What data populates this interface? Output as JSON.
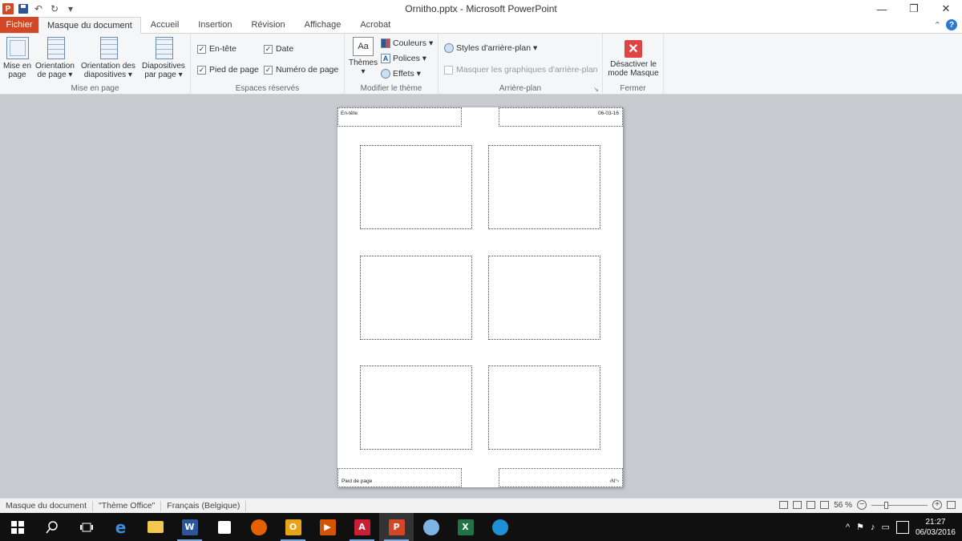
{
  "window": {
    "title": "Ornitho.pptx  -  Microsoft PowerPoint",
    "controls": {
      "minimize": "—",
      "restore": "❐",
      "close": "✕"
    },
    "app_logo": "P"
  },
  "quick_access": {
    "undo_arrow": "↶",
    "redo_arrow": "↻",
    "customize": "▾"
  },
  "tabs": {
    "file": "Fichier",
    "items": [
      "Masque du document",
      "Accueil",
      "Insertion",
      "Révision",
      "Affichage",
      "Acrobat"
    ],
    "collapse": "⌃",
    "help": "?"
  },
  "ribbon": {
    "mise_en_page": {
      "label": "Mise en page",
      "btn1_line1": "Mise en",
      "btn1_line2": "page",
      "btn2_line1": "Orientation",
      "btn2_line2": "de page ▾",
      "btn3_line1": "Orientation des",
      "btn3_line2": "diapositives ▾",
      "btn4_line1": "Diapositives",
      "btn4_line2": "par page ▾"
    },
    "espaces": {
      "label": "Espaces réservés",
      "entete": "En-tête",
      "date": "Date",
      "pied": "Pied de page",
      "numero": "Numéro de page",
      "check": "✓"
    },
    "theme": {
      "label": "Modifier le thème",
      "themes_line1": "Thèmes",
      "themes_line2": "▾",
      "themes_glyph": "Aa",
      "couleurs": "Couleurs ▾",
      "polices": "Polices ▾",
      "polices_glyph": "A",
      "effets": "Effets ▾"
    },
    "arriere_plan": {
      "label": "Arrière-plan",
      "styles": "Styles d'arrière-plan ▾",
      "masquer": "Masquer les graphiques d'arrière-plan",
      "launcher": "↘"
    },
    "fermer": {
      "label": "Fermer",
      "btn_line1": "Désactiver le",
      "btn_line2": "mode Masque",
      "btn_glyph": "✕"
    }
  },
  "handout": {
    "header": "En-tête",
    "date": "06-03-16",
    "footer": "Pied de page",
    "page_number": "‹N°›"
  },
  "status": {
    "mode": "Masque du document",
    "theme": "\"Thème Office\"",
    "language": "Français (Belgique)",
    "zoom": "56 %",
    "zoom_level_percent": 56,
    "zoom_out": "−",
    "zoom_in": "+"
  },
  "taskbar": {
    "time": "21:27",
    "date": "06/03/2016",
    "tray_up": "^"
  }
}
